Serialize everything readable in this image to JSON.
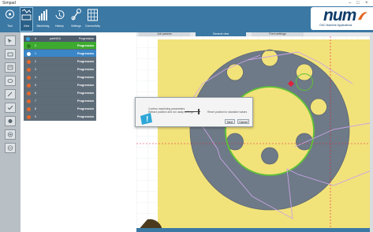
{
  "window": {
    "title": "Simpad"
  },
  "toolbar": {
    "buttons": [
      {
        "label": "Tool",
        "icon": "tool-icon"
      },
      {
        "label": "Jobs",
        "icon": "jobs-icon",
        "active": true
      },
      {
        "label": "Machining",
        "icon": "machining-icon"
      },
      {
        "label": "History",
        "icon": "history-icon"
      },
      {
        "label": "Settings",
        "icon": "settings-icon"
      },
      {
        "label": "Connectivity",
        "icon": "connectivity-icon"
      }
    ]
  },
  "logo": {
    "text": "num",
    "tagline": "CNC Machine Applications"
  },
  "sidebar": {
    "icons": [
      "pointer-icon",
      "open-icon",
      "program-icon",
      "view-icon",
      "edit-icon",
      "check-icon",
      "material-icon",
      "add-icon",
      "remove-icon"
    ]
  },
  "table": {
    "headers": {
      "num": "#",
      "name": "partNGU",
      "status": "Progression"
    },
    "rows": [
      {
        "idx": "0",
        "status": "Progression",
        "state": "done"
      },
      {
        "idx": "1",
        "status": "Progression",
        "state": "active"
      },
      {
        "idx": "2",
        "status": "Progression",
        "state": "pending"
      },
      {
        "idx": "3",
        "status": "Progression",
        "state": "pending"
      },
      {
        "idx": "4",
        "status": "Progression",
        "state": "pending"
      },
      {
        "idx": "5",
        "status": "Progression",
        "state": "pending"
      },
      {
        "idx": "6",
        "status": "Progression",
        "state": "pending"
      },
      {
        "idx": "7",
        "status": "Progression",
        "state": "pending"
      },
      {
        "idx": "8",
        "status": "Progression",
        "state": "pending"
      },
      {
        "idx": "9",
        "status": "Progression",
        "state": "pending"
      }
    ]
  },
  "tabs": [
    {
      "label": "Job params"
    },
    {
      "label": "General view",
      "active": true
    },
    {
      "label": "Form settings"
    }
  ],
  "dialog": {
    "message": "Confirm machining parameters",
    "slider_left": "Retract position and run away settings",
    "slider_right": "Reset position to standard values",
    "slider_level": 0.9,
    "ok_label": "Next",
    "cancel_label": "Cancel"
  },
  "colors": {
    "toolbar": "#3b78a4",
    "plate": "#f2e27a",
    "part": "#6e7a87",
    "hole_edge": "#5fc236",
    "toolpath": "#c9a4e6",
    "marker": "#e0203c"
  }
}
